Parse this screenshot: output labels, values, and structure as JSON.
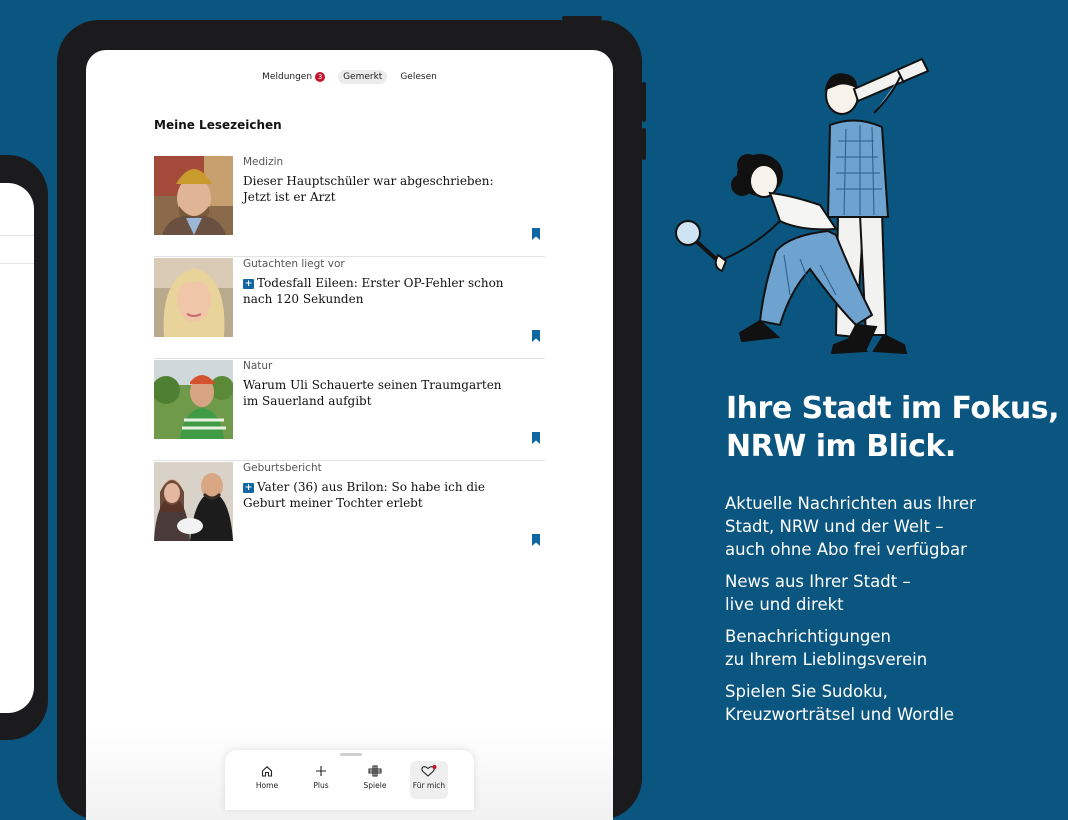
{
  "tabs": [
    {
      "label": "Meldungen",
      "badge": "3"
    },
    {
      "label": "Gemerkt"
    },
    {
      "label": "Gelesen"
    }
  ],
  "section_title": "Meine Lesezeichen",
  "articles": [
    {
      "kicker": "Medizin",
      "plus": false,
      "headline": "Dieser Hauptschüler war abgeschrieben: Jetzt ist er Arzt"
    },
    {
      "kicker": "Gutachten liegt vor",
      "plus": true,
      "headline": "Todesfall Eileen: Erster OP-Fehler schon nach 120 Sekunden"
    },
    {
      "kicker": "Natur",
      "plus": false,
      "headline": "Warum Uli Schauerte seinen Traumgarten im Sauerland aufgibt"
    },
    {
      "kicker": "Geburtsbericht",
      "plus": true,
      "headline": "Vater (36) aus Brilon: So habe ich die Geburt meiner Tochter erlebt"
    }
  ],
  "nav": {
    "home": "Home",
    "plus": "Plus",
    "games": "Spiele",
    "for_me": "Für mich"
  },
  "promo": {
    "headline_line1": "Ihre Stadt im Fokus,",
    "headline_line2": "NRW im Blick.",
    "features": [
      "Aktuelle Nachrichten aus Ihrer\nStadt, NRW und der Welt –\nauch ohne Abo frei verfügbar",
      "News aus Ihrer Stadt –\nlive und direkt",
      "Benachrichtigungen\nzu Ihrem Lieblingsverein",
      "Spielen Sie Sudoku,\nKreuzworträtsel und Wordle"
    ]
  },
  "colors": {
    "background": "#0b5680",
    "accent": "#1167a3",
    "badge": "#c4142b"
  }
}
